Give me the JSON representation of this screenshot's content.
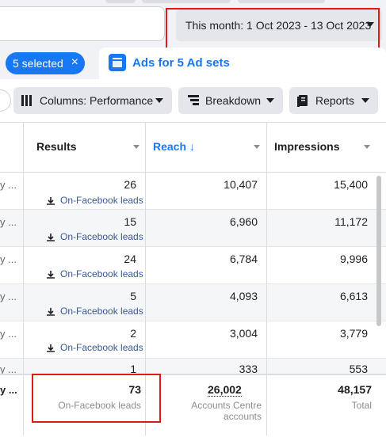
{
  "header": {
    "date_range_label": "This month: 1 Oct 2023 - 13 Oct 2023"
  },
  "tabs": {
    "selected_pill_label": "5 selected",
    "selected_pill_close": "×",
    "ads_tab_label": "Ads for 5 Ad sets"
  },
  "toolbar": {
    "columns_label": "Columns: Performance",
    "breakdown_label": "Breakdown",
    "reports_label": "Reports"
  },
  "table": {
    "columns": [
      "Results",
      "Reach ↓",
      "Impressions"
    ],
    "rows": [
      {
        "truncated": "y ...",
        "results": "26",
        "result_type": "On-Facebook leads",
        "reach": "10,407",
        "impressions": "15,400"
      },
      {
        "truncated": "y ...",
        "results": "15",
        "result_type": "On-Facebook leads",
        "reach": "6,960",
        "impressions": "11,172"
      },
      {
        "truncated": "y ...",
        "results": "24",
        "result_type": "On-Facebook leads",
        "reach": "6,784",
        "impressions": "9,996"
      },
      {
        "truncated": "y ...",
        "results": "5",
        "result_type": "On-Facebook leads",
        "reach": "4,093",
        "impressions": "6,613"
      },
      {
        "truncated": "y ...",
        "results": "2",
        "result_type": "On-Facebook leads",
        "reach": "3,004",
        "impressions": "3,779"
      },
      {
        "truncated": "y ...",
        "results": "1",
        "result_type": "",
        "reach": "333",
        "impressions": "553"
      }
    ],
    "totals": {
      "truncated": "y ...",
      "results": "73",
      "results_sub": "On-Facebook leads",
      "reach": "26,002",
      "reach_sub": "Accounts Centre accounts",
      "impressions": "48,157",
      "impressions_sub": "Total"
    }
  },
  "colors": {
    "accent": "#1877f2",
    "highlight_box": "#e01818"
  }
}
